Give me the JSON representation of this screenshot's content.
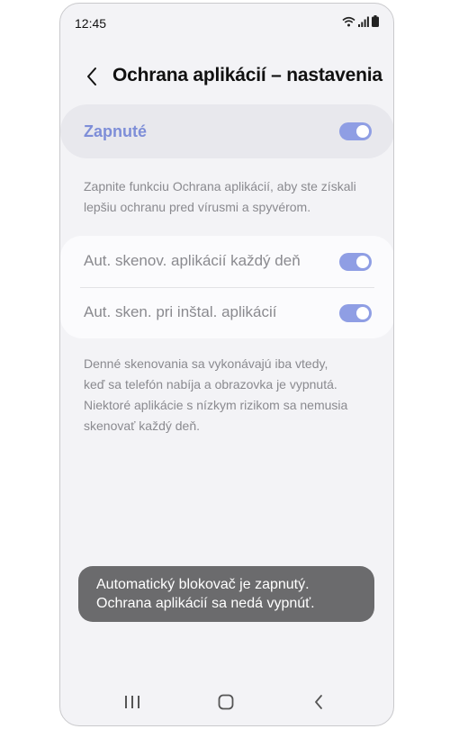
{
  "status_bar": {
    "time": "12:45"
  },
  "header": {
    "title": "Ochrana aplikácií – nastavenia"
  },
  "main_toggle": {
    "label": "Zapnuté",
    "enabled": true
  },
  "main_description": {
    "line1": "Zapnite funkciu Ochrana aplikácií, aby ste získali",
    "line2": "lepšiu ochranu pred vírusmi a spyvérom."
  },
  "settings": [
    {
      "label": "Aut. skenov. aplikácií každý deň",
      "enabled": true
    },
    {
      "label": "Aut. sken. pri inštal. aplikácií",
      "enabled": true
    }
  ],
  "scan_description": {
    "line1": "Denné skenovania sa vykonávajú iba vtedy,",
    "line2": "keď sa telefón nabíja a obrazovka je vypnutá.",
    "line3": "Niektoré aplikácie s nízkym rizikom sa nemusia",
    "line4": "skenovať každý deň."
  },
  "toast": {
    "line1": "Automatický blokovač je zapnutý.",
    "line2": "Ochrana aplikácií sa nedá vypnúť."
  },
  "colors": {
    "accent": "#8f9ee4",
    "accent_text": "#7e8ed8",
    "toast_bg": "#6b6b6d"
  }
}
